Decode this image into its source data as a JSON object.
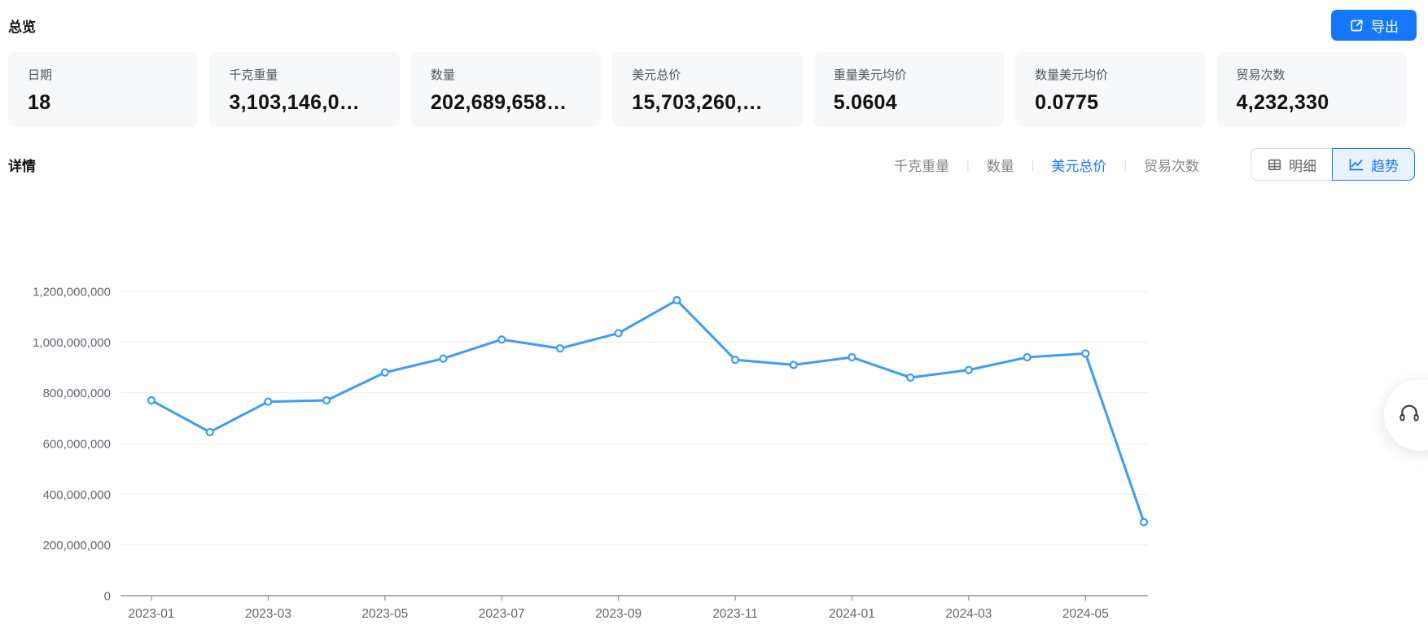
{
  "header": {
    "title": "总览",
    "export_label": "导出"
  },
  "stats": [
    {
      "label": "日期",
      "value": "18"
    },
    {
      "label": "千克重量",
      "value": "3,103,146,0…"
    },
    {
      "label": "数量",
      "value": "202,689,658…"
    },
    {
      "label": "美元总价",
      "value": "15,703,260,…"
    },
    {
      "label": "重量美元均价",
      "value": "5.0604"
    },
    {
      "label": "数量美元均价",
      "value": "0.0775"
    },
    {
      "label": "贸易次数",
      "value": "4,232,330"
    }
  ],
  "details": {
    "title": "详情",
    "metric_tabs": [
      {
        "label": "千克重量",
        "active": false
      },
      {
        "label": "数量",
        "active": false
      },
      {
        "label": "美元总价",
        "active": true
      },
      {
        "label": "贸易次数",
        "active": false
      }
    ],
    "view_toggle": [
      {
        "label": "明细",
        "icon": "table-icon",
        "active": false
      },
      {
        "label": "趋势",
        "icon": "trend-icon",
        "active": true
      }
    ]
  },
  "colors": {
    "accent": "#1677ff",
    "line": "#3d9cf4",
    "toggle_active_bg": "#e9f2ff",
    "card_bg": "#f7f8fa",
    "grid": "#e8ecf2",
    "axis": "#8f959e"
  },
  "floating": {
    "icon": "headset-icon"
  },
  "chart_data": {
    "type": "line",
    "title": "",
    "xlabel": "",
    "ylabel": "",
    "x": [
      "2023-01",
      "2023-02",
      "2023-03",
      "2023-04",
      "2023-05",
      "2023-06",
      "2023-07",
      "2023-08",
      "2023-09",
      "2023-10",
      "2023-11",
      "2023-12",
      "2024-01",
      "2024-02",
      "2024-03",
      "2024-04",
      "2024-05",
      "2024-06"
    ],
    "series": [
      {
        "name": "美元总价",
        "values": [
          770000000,
          645000000,
          765000000,
          770000000,
          880000000,
          935000000,
          1010000000,
          975000000,
          1035000000,
          1165000000,
          930000000,
          910000000,
          940000000,
          860000000,
          890000000,
          940000000,
          955000000,
          290000000
        ]
      }
    ],
    "ylim": [
      0,
      1200000000
    ],
    "ytick_interval": 200000000,
    "xtick_labels": [
      "2023-01",
      "2023-03",
      "2023-05",
      "2023-07",
      "2023-09",
      "2023-11",
      "2024-01",
      "2024-03",
      "2024-05"
    ],
    "grid": true,
    "legend": false
  }
}
